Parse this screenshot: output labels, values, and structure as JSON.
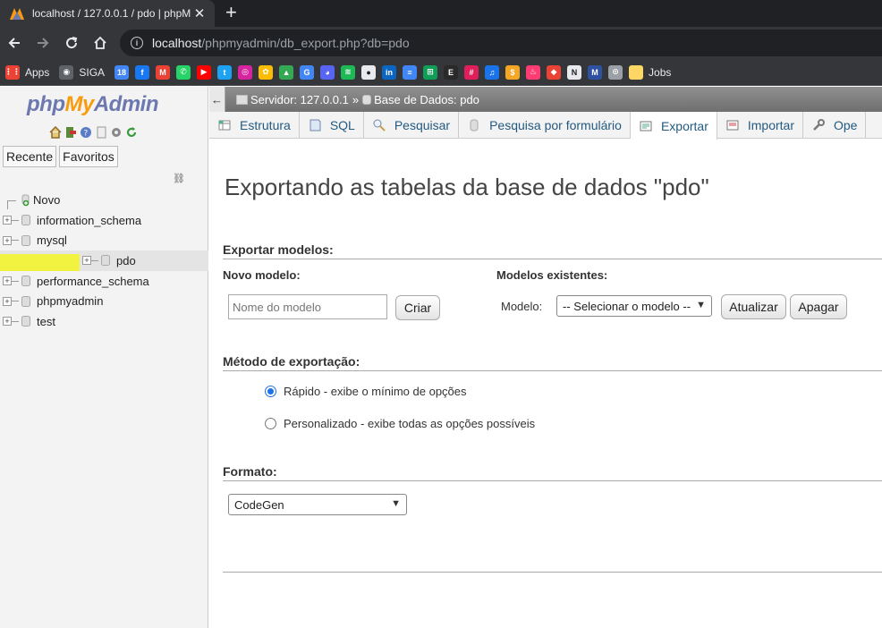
{
  "browser": {
    "tab_title": "localhost / 127.0.0.1 / pdo | phpM",
    "url_host": "localhost",
    "url_path": "/phpmyadmin/db_export.php?db=pdo",
    "bookmarks": [
      {
        "icon": "apps-grid-icon",
        "label": "Apps",
        "color": "#ea4335"
      },
      {
        "icon": "globe-icon",
        "label": "SIGA",
        "color": "#5f6368"
      },
      {
        "icon": "calendar-icon",
        "label": "",
        "color": "#4285f4"
      },
      {
        "icon": "facebook-icon",
        "label": "",
        "color": "#1877f2"
      },
      {
        "icon": "gmail-icon",
        "label": "",
        "color": "#ea4335"
      },
      {
        "icon": "whatsapp-icon",
        "label": "",
        "color": "#25d366"
      },
      {
        "icon": "youtube-icon",
        "label": "",
        "color": "#ff0000"
      },
      {
        "icon": "twitter-icon",
        "label": "",
        "color": "#1da1f2"
      },
      {
        "icon": "instagram-icon",
        "label": "",
        "color": "#d6249f"
      },
      {
        "icon": "photos-icon",
        "label": "",
        "color": "#fbbc04"
      },
      {
        "icon": "drive-icon",
        "label": "",
        "color": "#34a853"
      },
      {
        "icon": "translate-icon",
        "label": "",
        "color": "#4285f4"
      },
      {
        "icon": "discord-icon",
        "label": "",
        "color": "#5865f2"
      },
      {
        "icon": "spotify-icon",
        "label": "",
        "color": "#1db954"
      },
      {
        "icon": "github-icon",
        "label": "",
        "color": "#e8eaed"
      },
      {
        "icon": "linkedin-icon",
        "label": "",
        "color": "#0a66c2"
      },
      {
        "icon": "docs-icon",
        "label": "",
        "color": "#4285f4"
      },
      {
        "icon": "sheets-icon",
        "label": "",
        "color": "#0f9d58"
      },
      {
        "icon": "epic-icon",
        "label": "",
        "color": "#2a2a2a"
      },
      {
        "icon": "slack-icon",
        "label": "",
        "color": "#e01e5a"
      },
      {
        "icon": "mp3-icon",
        "label": "",
        "color": "#1a73e8"
      },
      {
        "icon": "dollar-icon",
        "label": "",
        "color": "#f5a623"
      },
      {
        "icon": "tinder-icon",
        "label": "",
        "color": "#fe3c72"
      },
      {
        "icon": "bag-icon",
        "label": "",
        "color": "#ea4335"
      },
      {
        "icon": "notion-icon",
        "label": "",
        "color": "#e8eaed"
      },
      {
        "icon": "mal-icon",
        "label": "",
        "color": "#2e51a2"
      },
      {
        "icon": "steam-icon",
        "label": "",
        "color": "#9aa0a6"
      },
      {
        "icon": "folder-icon",
        "label": "Jobs",
        "color": "#fdd663"
      }
    ]
  },
  "nav": {
    "logo": {
      "php": "php",
      "my": "My",
      "admin": "Admin"
    },
    "tab_recent": "Recente",
    "tab_favorites": "Favoritos",
    "tree": [
      {
        "label": "Novo",
        "kind": "new"
      },
      {
        "label": "information_schema",
        "kind": "db"
      },
      {
        "label": "mysql",
        "kind": "db"
      },
      {
        "label": "pdo",
        "kind": "db",
        "active": true
      },
      {
        "label": "performance_schema",
        "kind": "db"
      },
      {
        "label": "phpmyadmin",
        "kind": "db"
      },
      {
        "label": "test",
        "kind": "db"
      }
    ]
  },
  "breadcrumb": {
    "server": "Servidor: 127.0.0.1",
    "separator": "»",
    "database": "Base de Dados: pdo"
  },
  "menu": [
    {
      "label": "Estrutura",
      "icon": "structure-icon"
    },
    {
      "label": "SQL",
      "icon": "sql-icon"
    },
    {
      "label": "Pesquisar",
      "icon": "search-icon"
    },
    {
      "label": "Pesquisa por formulário",
      "icon": "query-icon"
    },
    {
      "label": "Exportar",
      "icon": "export-icon",
      "active": true
    },
    {
      "label": "Importar",
      "icon": "import-icon"
    },
    {
      "label": "Ope",
      "icon": "wrench-icon"
    }
  ],
  "content": {
    "title": "Exportando as tabelas da base de dados \"pdo\"",
    "templates_heading": "Exportar modelos:",
    "new_template_label": "Novo modelo:",
    "new_template_placeholder": "Nome do modelo",
    "create_button": "Criar",
    "existing_templates_label": "Modelos existentes:",
    "template_label": "Modelo:",
    "template_select": "-- Selecionar o modelo --",
    "update_button": "Atualizar",
    "delete_button": "Apagar",
    "method_heading": "Método de exportação:",
    "method_quick": "Rápido - exibe o mínimo de opções",
    "method_custom": "Personalizado - exibe todas as opções possíveis",
    "format_heading": "Formato:",
    "format_select": "CodeGen"
  }
}
